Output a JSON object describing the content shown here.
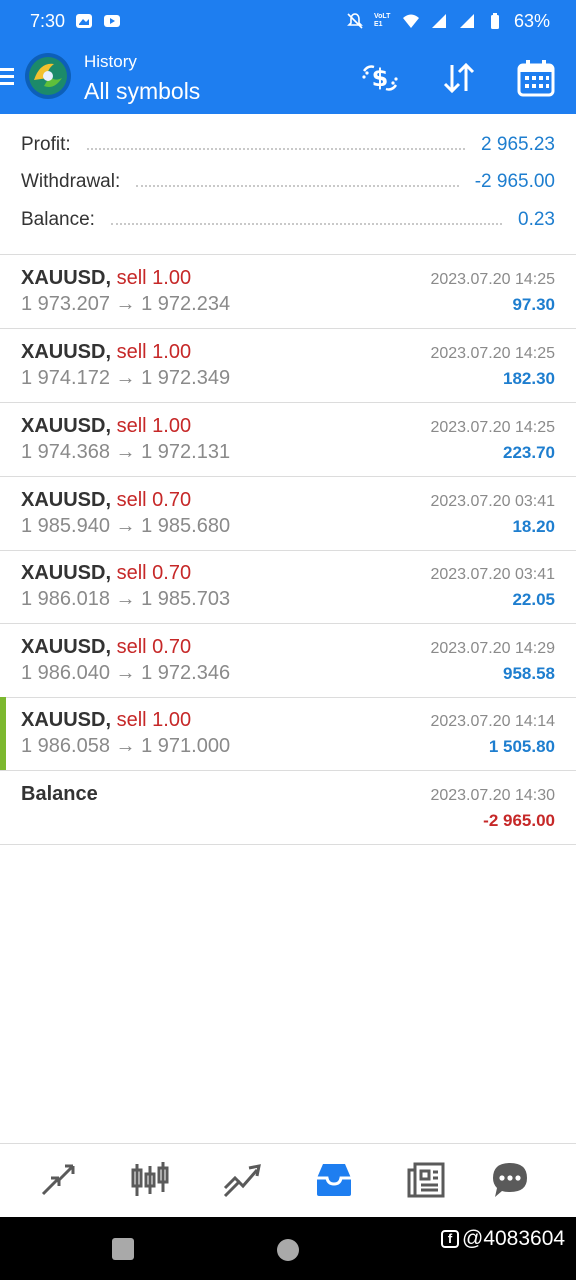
{
  "status_bar": {
    "time": "7:30",
    "volte": "VoLTE1",
    "battery": "63%"
  },
  "header": {
    "subtitle": "History",
    "title": "All symbols",
    "actions": [
      "deposit-icon",
      "sort-icon",
      "calendar-icon"
    ]
  },
  "summary": {
    "profit_label": "Profit:",
    "profit_value": "2 965.23",
    "withdrawal_label": "Withdrawal:",
    "withdrawal_value": "-2 965.00",
    "balance_label": "Balance:",
    "balance_value": "0.23"
  },
  "deals": [
    {
      "symbol": "XAUUSD,",
      "action": "sell 1.00",
      "prices": "1 973.207 → 1 972.234",
      "time": "2023.07.20 14:25",
      "profit": "97.30"
    },
    {
      "symbol": "XAUUSD,",
      "action": "sell 1.00",
      "prices": "1 974.172 → 1 972.349",
      "time": "2023.07.20 14:25",
      "profit": "182.30"
    },
    {
      "symbol": "XAUUSD,",
      "action": "sell 1.00",
      "prices": "1 974.368 → 1 972.131",
      "time": "2023.07.20 14:25",
      "profit": "223.70"
    },
    {
      "symbol": "XAUUSD,",
      "action": "sell 0.70",
      "prices": "1 985.940 → 1 985.680",
      "time": "2023.07.20 03:41",
      "profit": "18.20"
    },
    {
      "symbol": "XAUUSD,",
      "action": "sell 0.70",
      "prices": "1 986.018 → 1 985.703",
      "time": "2023.07.20 03:41",
      "profit": "22.05"
    },
    {
      "symbol": "XAUUSD,",
      "action": "sell 0.70",
      "prices": "1 986.040 → 1 972.346",
      "time": "2023.07.20 14:29",
      "profit": "958.58"
    },
    {
      "symbol": "XAUUSD,",
      "action": "sell 1.00",
      "prices": "1 986.058 → 1 971.000",
      "time": "2023.07.20 14:14",
      "profit": "1 505.80"
    }
  ],
  "balance_entry": {
    "label": "Balance",
    "time": "2023.07.20 14:30",
    "amount": "-2 965.00"
  },
  "tabs": [
    "quotes-icon",
    "chart-icon",
    "trade-icon",
    "history-icon",
    "news-icon",
    "chat-icon"
  ],
  "active_tab": "history-icon",
  "watermark": "@4083604",
  "colors": {
    "accent": "#1e7ef0",
    "sell": "#c62828",
    "profit": "#1e7ecf",
    "marker": "#7cb82f"
  }
}
